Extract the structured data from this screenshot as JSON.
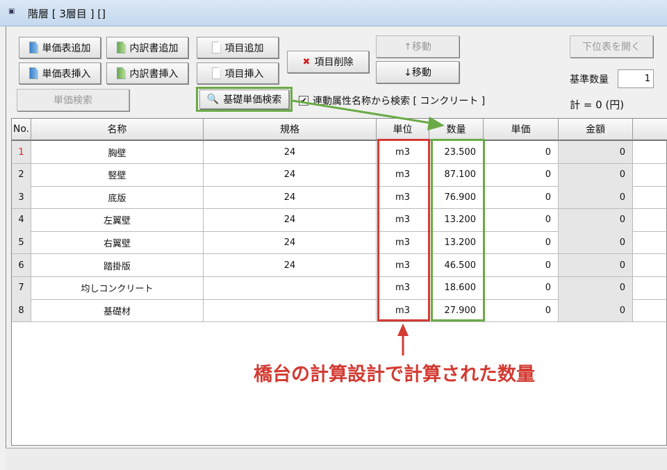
{
  "window": {
    "title": "階層 [ 3層目 ] []"
  },
  "toolbar": {
    "add_unit_table": "単価表追加",
    "add_breakdown": "内訳書追加",
    "add_item": "項目追加",
    "insert_unit_table": "単価表挿入",
    "insert_breakdown": "内訳書挿入",
    "insert_item": "項目挿入",
    "delete_item": "項目削除",
    "move_up": "↑移動",
    "move_down": "↓移動",
    "unit_price_search": "単価検索",
    "basic_unit_price_search": "基礎単価検索",
    "linked_search_label": "連動属性名称から検索 [ コンクリート ]",
    "linked_search_checked": true,
    "open_sub_table": "下位表を開く",
    "base_qty_label": "基準数量",
    "base_qty_value": "1",
    "total": "計 = 0 (円)"
  },
  "table": {
    "headers": [
      "No.",
      "名称",
      "規格",
      "単位",
      "数量",
      "単価",
      "金額"
    ],
    "rows": [
      {
        "no": "1",
        "name": "胸壁",
        "spec": "24",
        "unit": "m3",
        "qty": "23.500",
        "price": "0",
        "amount": "0"
      },
      {
        "no": "2",
        "name": "竪壁",
        "spec": "24",
        "unit": "m3",
        "qty": "87.100",
        "price": "0",
        "amount": "0"
      },
      {
        "no": "3",
        "name": "底版",
        "spec": "24",
        "unit": "m3",
        "qty": "76.900",
        "price": "0",
        "amount": "0"
      },
      {
        "no": "4",
        "name": "左翼壁",
        "spec": "24",
        "unit": "m3",
        "qty": "13.200",
        "price": "0",
        "amount": "0"
      },
      {
        "no": "5",
        "name": "右翼壁",
        "spec": "24",
        "unit": "m3",
        "qty": "13.200",
        "price": "0",
        "amount": "0"
      },
      {
        "no": "6",
        "name": "踏掛版",
        "spec": "24",
        "unit": "m3",
        "qty": "46.500",
        "price": "0",
        "amount": "0"
      },
      {
        "no": "7",
        "name": "均しコンクリート",
        "spec": "",
        "unit": "m3",
        "qty": "18.600",
        "price": "0",
        "amount": "0"
      },
      {
        "no": "8",
        "name": "基礎材",
        "spec": "",
        "unit": "m3",
        "qty": "27.900",
        "price": "0",
        "amount": "0"
      }
    ]
  },
  "annotation": {
    "caption": "橋台の計算設計で計算された数量",
    "red": "#d33a32",
    "green": "#6aaa46"
  }
}
